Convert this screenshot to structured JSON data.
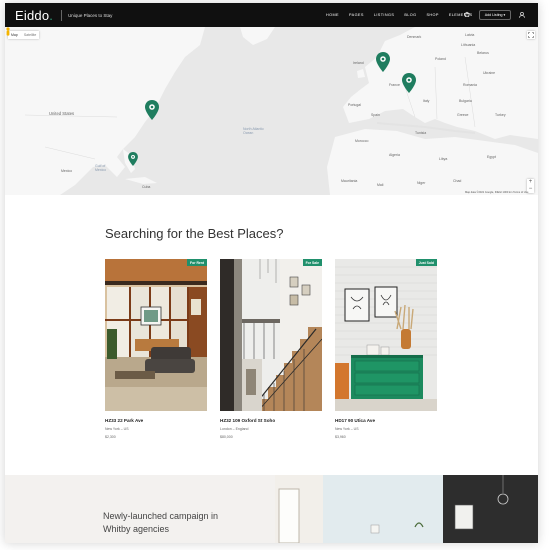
{
  "header": {
    "logo": "Eiddo",
    "logo_dot": ".",
    "tagline": "Unique Places to Stay",
    "nav": [
      "HOME",
      "PAGES",
      "LISTINGS",
      "BLOG",
      "SHOP",
      "ELEMENTS"
    ],
    "add_listing_label": "Add Listing ▾",
    "accent_color": "#2ca07a"
  },
  "map": {
    "toggle": [
      "Map",
      "Satellite"
    ],
    "labels": {
      "united_states": "United States",
      "mexico": "Mexico",
      "gulf": "Gulf of\nMexico",
      "cuba": "Cuba",
      "north_atlantic": "North Atlantic\nOcean",
      "latvia": "Latvia",
      "lithuania": "Lithuania",
      "denmark": "Denmark",
      "belarus": "Belarus",
      "ireland": "Ireland",
      "poland": "Poland",
      "ukraine": "Ukraine",
      "france": "France",
      "italy": "Italy",
      "romania": "Romania",
      "bulgaria": "Bulgaria",
      "portugal": "Portugal",
      "spain": "Spain",
      "greece": "Greece",
      "turkey": "Turkey",
      "tunisia": "Tunisia",
      "morocco": "Morocco",
      "algeria": "Algeria",
      "libya": "Libya",
      "egypt": "Egypt",
      "mauritania": "Mauritania",
      "mali": "Mali",
      "niger": "Niger",
      "chad": "Chad"
    },
    "zoom_in": "+",
    "zoom_out": "−",
    "attribution": "Map data ©2021 Google, INEGI  1000 km  Terms of Use"
  },
  "section": {
    "title": "Searching for the Best Places?"
  },
  "listings": [
    {
      "badge": "For Rent",
      "title": "HZ33 22 Park Ave",
      "location": "New York – US",
      "price": "$2,300"
    },
    {
      "badge": "For Sale",
      "title": "HZ32 109 Oxford St Soho",
      "location": "London – England",
      "price": "$80,000"
    },
    {
      "badge": "Just Sold",
      "title": "HD17 90 Utica Ave",
      "location": "New York – US",
      "price": "$3,960"
    }
  ],
  "banner": {
    "text": "Newly-launched campaign in Whitby agencies"
  }
}
